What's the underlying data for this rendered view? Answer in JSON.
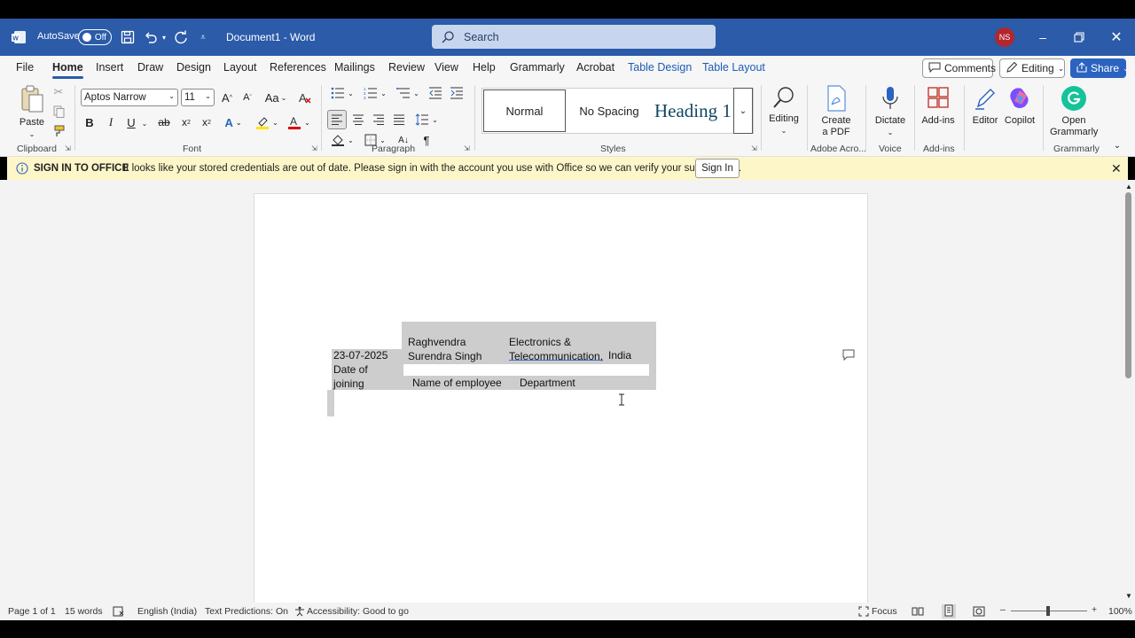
{
  "titlebar": {
    "autosave_label": "AutoSave",
    "autosave_state": "Off",
    "doc_title": "Document1  -  Word",
    "search_placeholder": "Search",
    "avatar_initials": "NS"
  },
  "menu": {
    "tabs": [
      "File",
      "Home",
      "Insert",
      "Draw",
      "Design",
      "Layout",
      "References",
      "Mailings",
      "Review",
      "View",
      "Help",
      "Grammarly",
      "Acrobat",
      "Table Design",
      "Table Layout"
    ],
    "active_tab": "Home",
    "comments_label": "Comments",
    "editing_label": "Editing",
    "share_label": "Share"
  },
  "ribbon": {
    "clipboard": {
      "paste_label": "Paste",
      "group_label": "Clipboard"
    },
    "font": {
      "font_name": "Aptos Narrow",
      "font_size": "11",
      "group_label": "Font"
    },
    "paragraph": {
      "group_label": "Paragraph"
    },
    "styles": {
      "normal": "Normal",
      "no_spacing": "No Spacing",
      "heading": "Heading 1",
      "group_label": "Styles"
    },
    "editing": {
      "label": "Editing"
    },
    "adobe": {
      "label": "Create a PDF",
      "group_label": "Adobe Acro..."
    },
    "voice": {
      "label": "Dictate",
      "group_label": "Voice"
    },
    "addins": {
      "label": "Add-ins",
      "group_label": "Add-ins"
    },
    "editor": {
      "label": "Editor"
    },
    "copilot": {
      "label": "Copilot"
    },
    "grammarly": {
      "label": "Open Grammarly",
      "group_label": "Grammarly"
    }
  },
  "infobar": {
    "title": "SIGN IN TO OFFICE",
    "message": "It looks like your stored credentials are out of date. Please sign in with the account you use with Office so we can verify your subscription.",
    "button": "Sign In"
  },
  "document": {
    "row1": {
      "name": "Raghvendra Surendra Singh",
      "department": "Electronics & Telecommunication,",
      "country": "India",
      "date": "23-07-2025"
    },
    "row2": {
      "date_header": "Date of joining",
      "name_header": "Name of employee",
      "dept_header": "Department"
    }
  },
  "statusbar": {
    "page": "Page 1 of 1",
    "words": "15 words",
    "language": "English (India)",
    "predictions": "Text Predictions: On",
    "accessibility": "Accessibility: Good to go",
    "focus": "Focus",
    "zoom": "100%"
  },
  "colors": {
    "titlebar": "#2b5ba9",
    "infobar": "#fdf6c8",
    "cell_shade": "#cdcdcd"
  }
}
